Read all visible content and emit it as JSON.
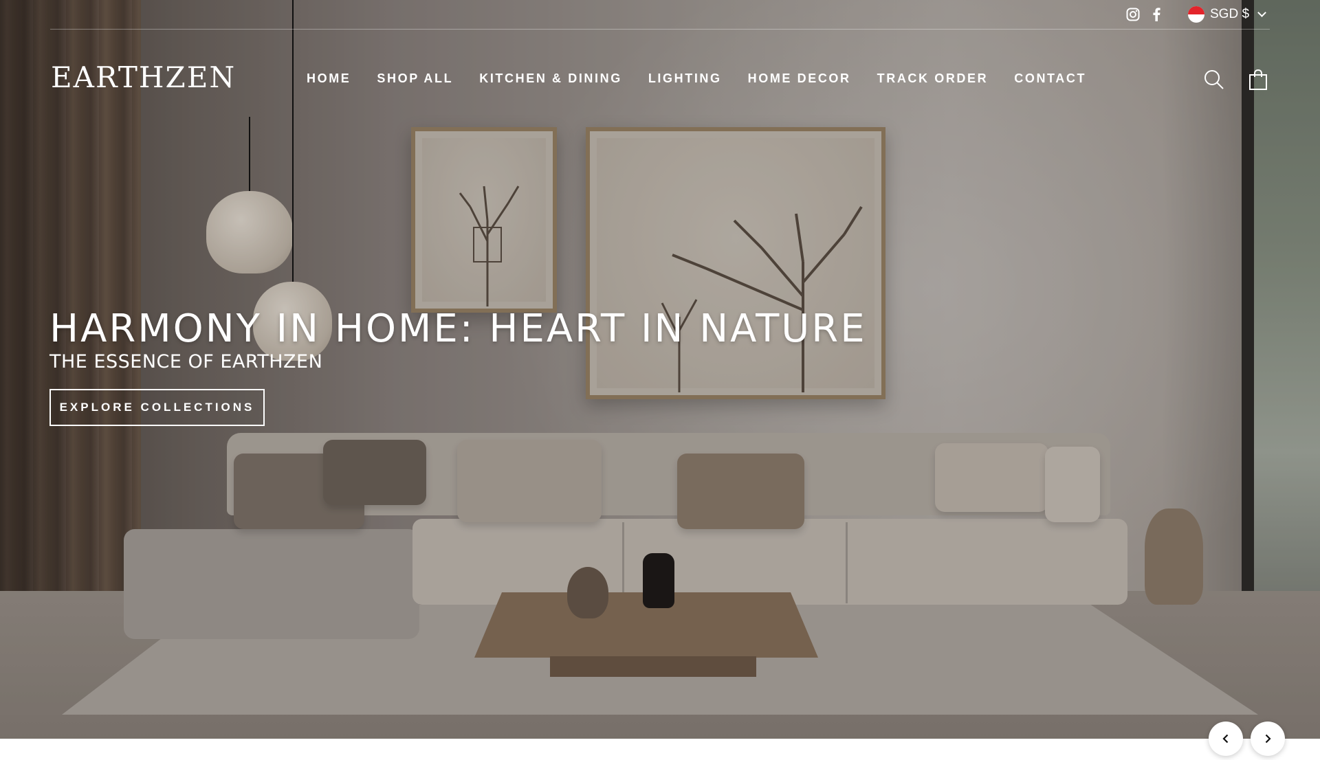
{
  "brand": {
    "logo_text": "EARTHZEN"
  },
  "utility_bar": {
    "social": [
      {
        "name": "instagram-icon"
      },
      {
        "name": "facebook-icon"
      }
    ],
    "currency": {
      "label": "SGD $",
      "flag": "singapore-flag-icon"
    }
  },
  "nav": {
    "items": [
      {
        "label": "HOME"
      },
      {
        "label": "SHOP ALL"
      },
      {
        "label": "KITCHEN & DINING"
      },
      {
        "label": "LIGHTING"
      },
      {
        "label": "HOME DECOR"
      },
      {
        "label": "TRACK ORDER"
      },
      {
        "label": "CONTACT"
      }
    ]
  },
  "header_icons": {
    "search": "search-icon",
    "cart": "cart-icon"
  },
  "hero": {
    "title": "HARMONY IN HOME: HEART IN NATURE",
    "subtitle": "THE ESSENCE OF EARTHZEN",
    "cta_label": "EXPLORE COLLECTIONS"
  },
  "slider": {
    "prev": "chevron-left-icon",
    "next": "chevron-right-icon"
  },
  "colors": {
    "header_text": "#ffffff",
    "flag_red": "#e3242b"
  }
}
